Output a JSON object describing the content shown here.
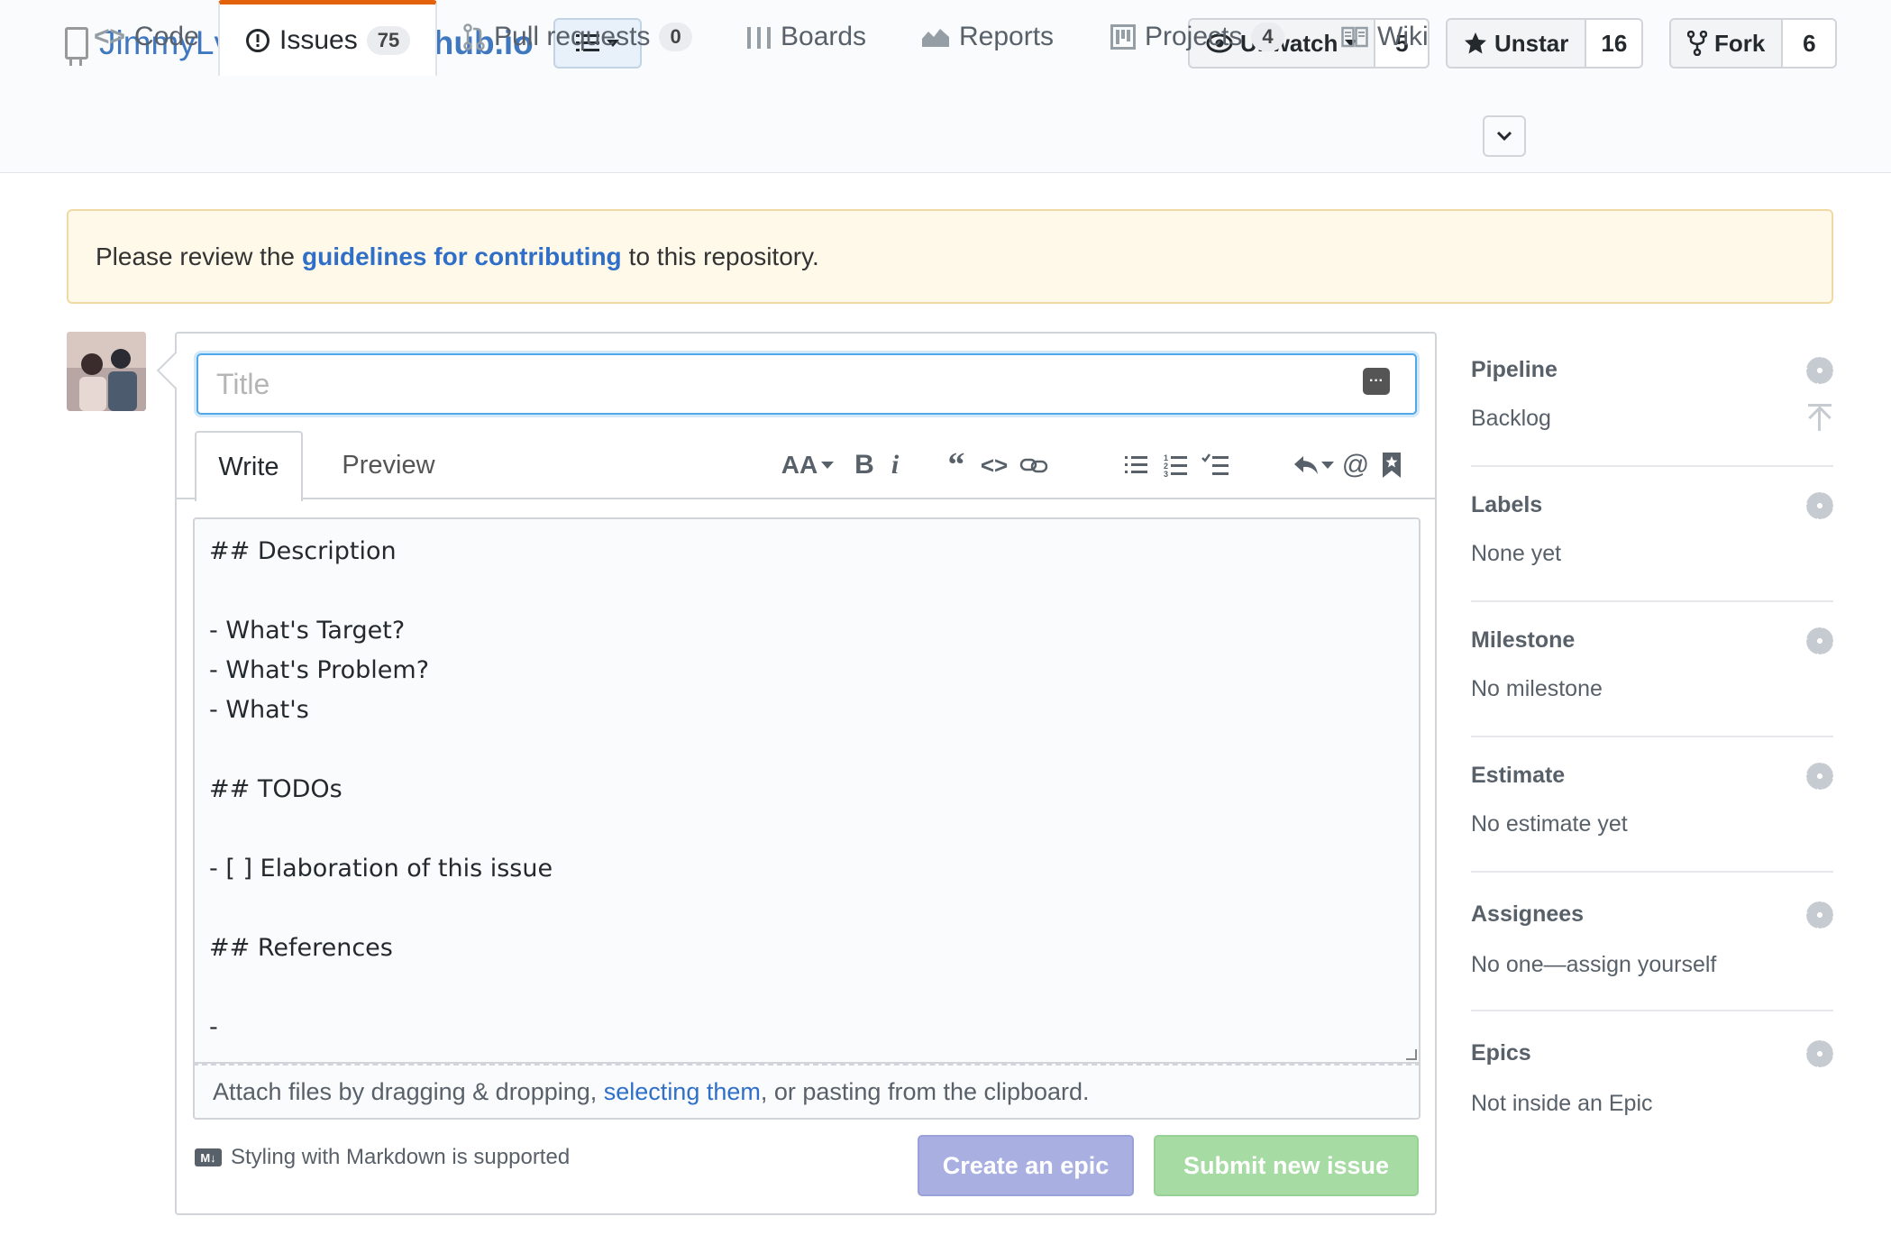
{
  "repo": {
    "owner": "JimmyLv",
    "separator": "/",
    "name": "jimmylv.github.io"
  },
  "actions": {
    "watch_label": "Unwatch",
    "watch_count": "5",
    "star_label": "Unstar",
    "star_count": "16",
    "fork_label": "Fork",
    "fork_count": "6"
  },
  "tabs": [
    {
      "label": "Code",
      "count": null,
      "icon": "code-icon"
    },
    {
      "label": "Issues",
      "count": "75",
      "icon": "issue-opened-icon"
    },
    {
      "label": "Pull requests",
      "count": "0",
      "icon": "git-pull-request-icon"
    },
    {
      "label": "Boards",
      "count": null,
      "icon": "boards-icon"
    },
    {
      "label": "Reports",
      "count": null,
      "icon": "graph-icon"
    },
    {
      "label": "Projects",
      "count": "4",
      "icon": "project-icon"
    },
    {
      "label": "Wiki",
      "count": null,
      "icon": "book-icon"
    }
  ],
  "flash": {
    "prefix": "Please review the",
    "link": "guidelines for contributing",
    "suffix": "to this repository."
  },
  "issue_form": {
    "title_placeholder": "Title",
    "title_value": "",
    "write_tab": "Write",
    "preview_tab": "Preview",
    "body": "## Description\n\n- What's Target?\n- What's Problem?\n- What's\n\n## TODOs\n\n- [ ] Elaboration of this issue\n\n## References\n\n-",
    "attach_prefix": "Attach files by dragging & dropping,",
    "attach_link": "selecting them",
    "attach_suffix": ", or pasting from the clipboard.",
    "markdown_note": "Styling with Markdown is supported",
    "markdown_badge": "M↓",
    "create_epic": "Create an epic",
    "submit": "Submit new issue"
  },
  "sidebar": {
    "sections": [
      {
        "heading": "Pipeline",
        "value": "Backlog"
      },
      {
        "heading": "Labels",
        "value": "None yet"
      },
      {
        "heading": "Milestone",
        "value": "No milestone"
      },
      {
        "heading": "Estimate",
        "value": "No estimate yet"
      },
      {
        "heading": "Assignees",
        "value": "No one—assign yourself"
      },
      {
        "heading": "Epics",
        "value": "Not inside an Epic"
      }
    ]
  },
  "colors": {
    "link": "#4078c0",
    "selected_tab_accent": "#e36209",
    "flash_bg": "#fff9ea",
    "epic_button": "#a9b0e1",
    "submit_button": "#a6dba3",
    "focus_border": "#51a7e8"
  }
}
